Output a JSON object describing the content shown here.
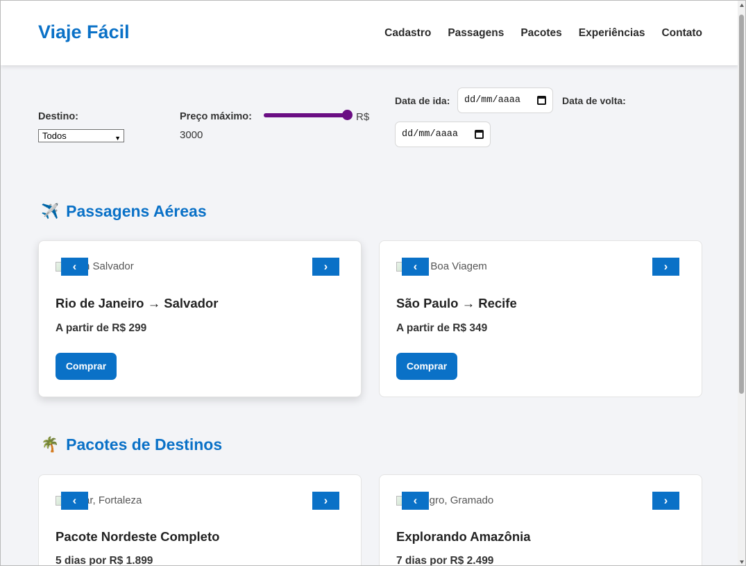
{
  "header": {
    "logo": "Viaje Fácil",
    "nav": [
      "Cadastro",
      "Passagens",
      "Pacotes",
      "Experiências",
      "Contato"
    ]
  },
  "filters": {
    "destino_label": "Destino:",
    "destino_value": "Todos",
    "preco_label": "Preço máximo:",
    "preco_value": "3000",
    "preco_fraction": 1.0,
    "currency": "R$",
    "ida_label": "Data de ida:",
    "ida_placeholder": "dd/mm/aaaa",
    "volta_label": "Data de volta:",
    "volta_placeholder": "dd/mm/aaaa"
  },
  "sections": {
    "passagens": {
      "emoji": "✈️",
      "title": "Passagens Aéreas",
      "cards": [
        {
          "alt": "a em Salvador",
          "title": "Rio de Janeiro → Salvador",
          "price": "A partir de R$ 299",
          "button": "Comprar"
        },
        {
          "alt": "a de Boa Viagem",
          "title": "São Paulo → Recife",
          "price": "A partir de R$ 349",
          "button": "Comprar"
        }
      ]
    },
    "pacotes": {
      "emoji": "🌴",
      "title": "Pacotes de Destinos",
      "cards": [
        {
          "alt": "a mar, Fortaleza",
          "title": "Pacote Nordeste Completo",
          "price": "5 dias por R$ 1.899"
        },
        {
          "alt": "o Negro, Gramado",
          "title": "Explorando Amazônia",
          "price": "7 dias por R$ 2.499"
        }
      ]
    }
  },
  "carousel": {
    "prev": "‹",
    "next": "›"
  },
  "colors": {
    "brand": "#0a71c7",
    "slider": "#6a0d83",
    "background": "#f3f4f7"
  }
}
